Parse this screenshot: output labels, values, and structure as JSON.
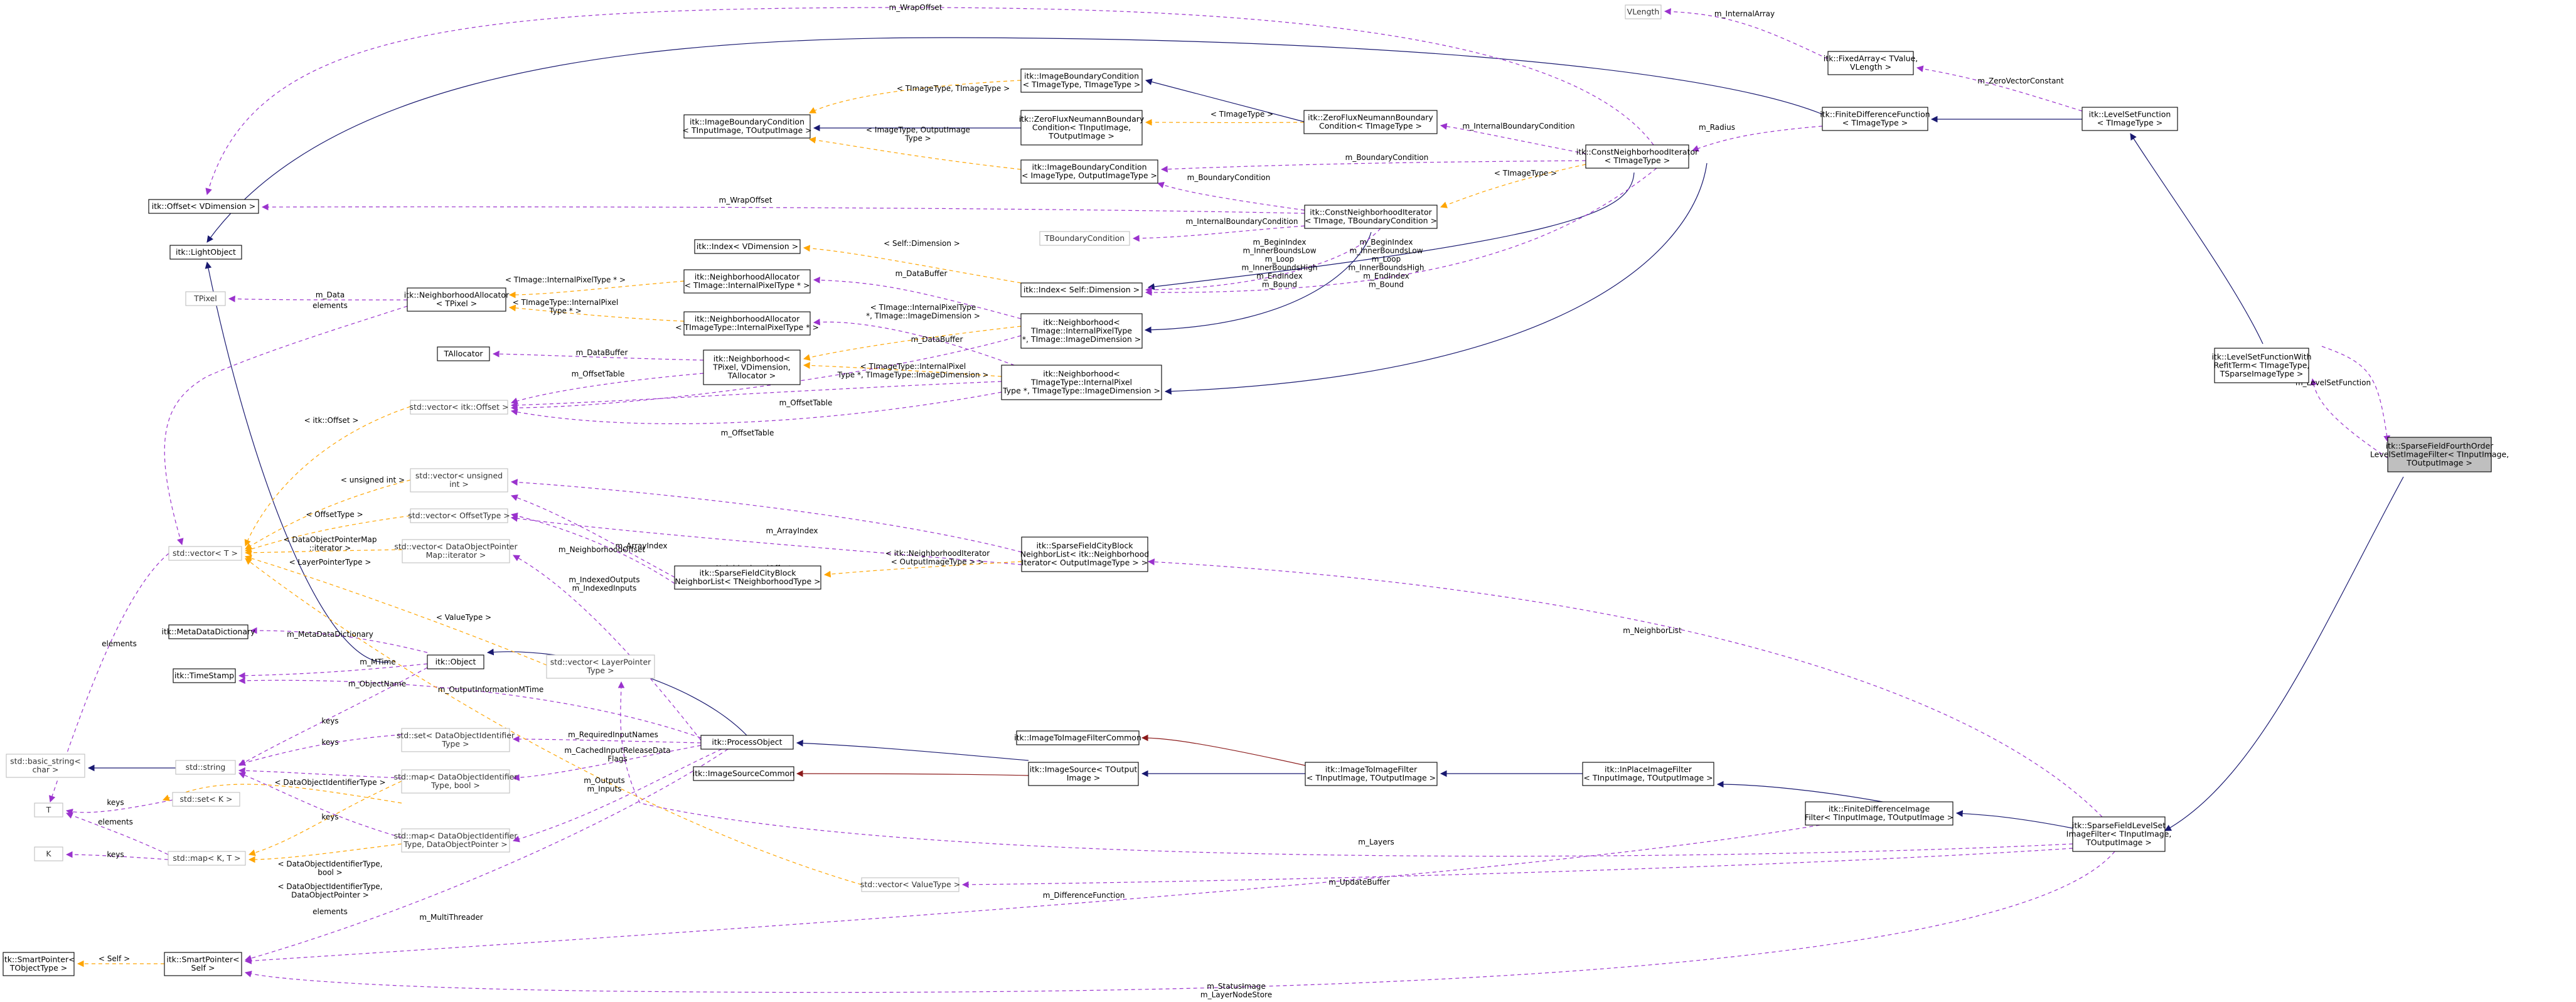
{
  "colors": {
    "inheritance": "#191970",
    "usage": "#9a32cd",
    "template": "#ffa500",
    "private_inheritance": "#8b1a1a",
    "root_fill": "#bfbfbf",
    "faded_border": "#bfbfbf"
  },
  "nodes": {
    "root": [
      "itk::SparseFieldFourthOrder",
      "LevelSetImageFilter< TInputImage,",
      "TOutputImage >"
    ],
    "sparse_field_level_set": [
      "itk::SparseFieldLevelSet",
      "ImageFilter< TInputImage,",
      "TOutputImage >"
    ],
    "level_set_function_with_refit": [
      "itk::LevelSetFunctionWith",
      "RefitTerm< TImageType,",
      "TSparseImageType >"
    ],
    "level_set_function": [
      "itk::LevelSetFunction",
      "< TImageType >"
    ],
    "finite_difference_function": [
      "itk::FiniteDifferenceFunction",
      "< TImageType >"
    ],
    "fixed_array": [
      "itk::FixedArray< TValue,",
      "VLength >"
    ],
    "vlength": [
      "VLength"
    ],
    "const_neighborhood_iterator": [
      "itk::ConstNeighborhoodIterator",
      "< TImageType >"
    ],
    "zero_flux_1": [
      "itk::ZeroFluxNeumannBoundary",
      "Condition< TImageType >"
    ],
    "image_boundary_cond_1": [
      "itk::ImageBoundaryCondition",
      "< TImageType, TImageType >"
    ],
    "zero_flux_2": [
      "itk::ZeroFluxNeumannBoundary",
      "Condition< TInputImage,",
      "TOutputImage >"
    ],
    "image_boundary_cond_main": [
      "itk::ImageBoundaryCondition",
      "< TInputImage, TOutputImage >"
    ],
    "image_boundary_cond_2": [
      "itk::ImageBoundaryCondition",
      "< ImageType, OutputImageType >"
    ],
    "const_neighborhood_iterator_2": [
      "itk::ConstNeighborhoodIterator",
      "< TImage, TBoundaryCondition >"
    ],
    "tboundary_condition": [
      "TBoundaryCondition"
    ],
    "offset": [
      "itk::Offset< VDimension >"
    ],
    "light_object": [
      "itk::LightObject"
    ],
    "index_vdim": [
      "itk::Index< VDimension >"
    ],
    "index_self": [
      "itk::Index< Self::Dimension >"
    ],
    "neighborhood_alloc_1": [
      "itk::NeighborhoodAllocator",
      "< TImage::InternalPixelType * >"
    ],
    "neighborhood_alloc_main": [
      "itk::NeighborhoodAllocator",
      "< TPixel >"
    ],
    "neighborhood_alloc_2": [
      "itk::NeighborhoodAllocator",
      "< TImageType::InternalPixelType * >"
    ],
    "tpixel": [
      "TPixel"
    ],
    "neighborhood_1": [
      "itk::Neighborhood<",
      "TImage::InternalPixelType",
      "*, TImage::ImageDimension >"
    ],
    "tallocator": [
      "TAllocator"
    ],
    "neighborhood_main": [
      "itk::Neighborhood<",
      "TPixel, VDimension,",
      "TAllocator >"
    ],
    "neighborhood_2": [
      "itk::Neighborhood<",
      "TImageType::InternalPixel",
      "Type *, TImageType::ImageDimension >"
    ],
    "vector_offset": [
      "std::vector< itk::Offset >"
    ],
    "vector_unsigned": [
      "std::vector< unsigned",
      "int >"
    ],
    "vector_offset_type": [
      "std::vector< OffsetType >"
    ],
    "vector_dop_iter": [
      "std::vector< DataObjectPointer",
      "Map::iterator >"
    ],
    "vector_t": [
      "std::vector< T >"
    ],
    "cityblock_nl_1": [
      "itk::SparseFieldCityBlock",
      "NeighborList< itk::Neighborhood",
      "Iterator< OutputImageType > >"
    ],
    "cityblock_nl_2": [
      "itk::SparseFieldCityBlock",
      "NeighborList< TNeighborhoodType >"
    ],
    "meta_data_dictionary": [
      "itk::MetaDataDictionary"
    ],
    "object": [
      "itk::Object"
    ],
    "time_stamp": [
      "itk::TimeStamp"
    ],
    "vector_layer_pointer": [
      "std::vector< LayerPointer",
      "Type >"
    ],
    "basic_string": [
      "std::basic_string<",
      "char >"
    ],
    "string": [
      "std::string"
    ],
    "set_doi": [
      "std::set< DataObjectIdentifier",
      "Type >"
    ],
    "map_doi_bool": [
      "std::map< DataObjectIdentifier",
      "Type, bool >"
    ],
    "process_object": [
      "itk::ProcessObject"
    ],
    "image_to_image_filter_common": [
      "itk::ImageToImageFilterCommon"
    ],
    "image_source_common": [
      "itk::ImageSourceCommon"
    ],
    "image_source": [
      "itk::ImageSource< TOutput",
      "Image >"
    ],
    "image_to_image_filter": [
      "itk::ImageToImageFilter",
      "< TInputImage, TOutputImage >"
    ],
    "in_place_filter": [
      "itk::InPlaceImageFilter",
      "< TInputImage, TOutputImage >"
    ],
    "finite_difference_image_filter": [
      "itk::FiniteDifferenceImage",
      "Filter< TInputImage, TOutputImage >"
    ],
    "t": [
      "T"
    ],
    "set_k": [
      "std::set< K >"
    ],
    "map_doi_dop": [
      "std::map< DataObjectIdentifier",
      "Type, DataObjectPointer >"
    ],
    "k": [
      "K"
    ],
    "map_kt": [
      "std::map< K, T >"
    ],
    "vector_value_type": [
      "std::vector< ValueType >"
    ],
    "smart_pointer_tobject": [
      "itk::SmartPointer<",
      "TObjectType >"
    ],
    "smart_pointer_self": [
      "itk::SmartPointer<",
      "Self >"
    ]
  },
  "edge_labels": {
    "wrap_offset_top": [
      "m_WrapOffset"
    ],
    "internal_array": [
      "m_InternalArray"
    ],
    "zero_vector_constant": [
      "m_ZeroVectorConstant"
    ],
    "radius": [
      "m_Radius"
    ],
    "internal_boundary_condition": [
      "m_InternalBoundaryCondition"
    ],
    "timage_timage": [
      "< TImageType, TImageType >"
    ],
    "timagetype_1": [
      "< TImageType >"
    ],
    "image_output_type": [
      "< ImageType, OutputImage",
      "Type >"
    ],
    "boundary_condition_1": [
      "m_BoundaryCondition"
    ],
    "timagetype_2": [
      "< TImageType >"
    ],
    "boundary_condition_2": [
      "m_BoundaryCondition"
    ],
    "wrap_offset_mid": [
      "m_WrapOffset"
    ],
    "internal_boundary_condition_2": [
      "m_InternalBoundaryCondition"
    ],
    "self_dimension": [
      "< Self::Dimension >"
    ],
    "begin_index_1": [
      "m_BeginIndex",
      "m_InnerBoundsLow",
      "m_Loop",
      "m_InnerBoundsHigh",
      "m_EndIndex",
      "m_Bound"
    ],
    "begin_index_2": [
      "m_BeginIndex",
      "m_InnerBoundsLow",
      "m_Loop",
      "m_InnerBoundsHigh",
      "m_EndIndex",
      "m_Bound"
    ],
    "data": [
      "m_Data"
    ],
    "elements_1": [
      "elements"
    ],
    "internal_pixel_type_1": [
      "< TImage::InternalPixelType * >"
    ],
    "internal_pixel_type_2": [
      "< TImageType::InternalPixel",
      "Type * >"
    ],
    "data_buffer_1": [
      "m_DataBuffer"
    ],
    "data_buffer_2": [
      "m_DataBuffer"
    ],
    "data_buffer_3": [
      "m_DataBuffer"
    ],
    "timage_internal": [
      "< TImage::InternalPixelType",
      "*, TImage::ImageDimension >"
    ],
    "timagetype_internal": [
      "< TImageType::InternalPixel",
      "Type *, TImageType::ImageDimension >"
    ],
    "offset_table_1": [
      "m_OffsetTable"
    ],
    "offset_table_2": [
      "m_OffsetTable"
    ],
    "offset_table_3": [
      "m_OffsetTable"
    ],
    "level_set_function": [
      "m_LevelSetFunction"
    ],
    "itk_offset": [
      "< itk::Offset >"
    ],
    "unsigned_int": [
      "< unsigned int >"
    ],
    "array_index_1": [
      "m_ArrayIndex"
    ],
    "array_index_2": [
      "m_ArrayIndex"
    ],
    "offset_type": [
      "< OffsetType >"
    ],
    "neighborhood_offset_1": [
      "m_NeighborhoodOffset"
    ],
    "neighborhood_offset_2": [
      "m_NeighborhoodOffset"
    ],
    "dop_map_iter": [
      "< DataObjectPointerMap",
      "::iterator >"
    ],
    "layer_pointer_type": [
      "< LayerPointerType >"
    ],
    "neighborhood_iterator": [
      "< itk::NeighborhoodIterator",
      "< OutputImageType > >"
    ],
    "indexed_outputs": [
      "m_IndexedOutputs",
      "m_IndexedInputs"
    ],
    "elements_2": [
      "elements"
    ],
    "meta_data_dictionary": [
      "m_MetaDataDictionary"
    ],
    "value_type_1": [
      "< ValueType >"
    ],
    "neighbor_list": [
      "m_NeighborList"
    ],
    "m_time": [
      "m_MTime"
    ],
    "object_name": [
      "m_ObjectName"
    ],
    "output_information_mtime": [
      "m_OutputInformationMTime"
    ],
    "keys_1": [
      "keys"
    ],
    "required_input_names": [
      "m_RequiredInputNames"
    ],
    "keys_2": [
      "keys"
    ],
    "cached_input_release": [
      "m_CachedInputReleaseData",
      "Flags"
    ],
    "doi_type": [
      "< DataObjectIdentifierType >"
    ],
    "keys_3": [
      "keys"
    ],
    "outputs_inputs": [
      "m_Outputs",
      "m_Inputs"
    ],
    "keys_4": [
      "keys"
    ],
    "elements_3": [
      "elements"
    ],
    "keys_5": [
      "keys"
    ],
    "doi_type_bool": [
      "< DataObjectIdentifierType,",
      "bool >"
    ],
    "layers": [
      "m_Layers"
    ],
    "doi_type_dop": [
      "< DataObjectIdentifierType,",
      "DataObjectPointer >"
    ],
    "elements_4": [
      "elements"
    ],
    "update_buffer": [
      "m_UpdateBuffer"
    ],
    "difference_function": [
      "m_DifferenceFunction"
    ],
    "multi_threader": [
      "m_MultiThreader"
    ],
    "self": [
      "< Self >"
    ],
    "status_image": [
      "m_StatusImage",
      "m_LayerNodeStore"
    ]
  }
}
